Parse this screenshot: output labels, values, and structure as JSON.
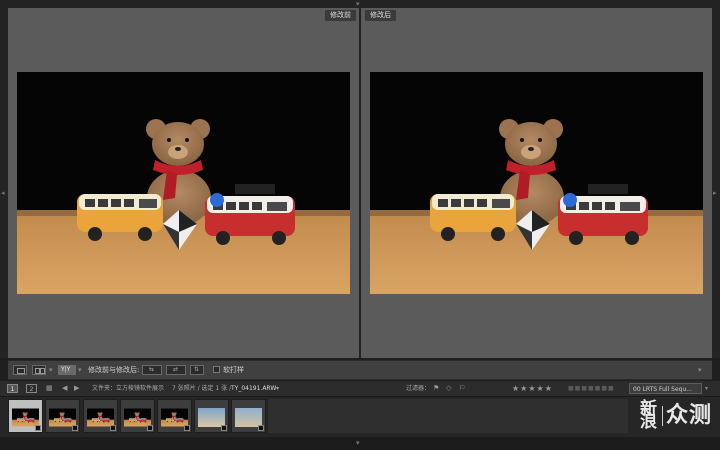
{
  "panes": {
    "before_label": "修改前",
    "after_label": "修改后"
  },
  "toolbar": {
    "view_mode_icons": [
      "loupe-icon",
      "compare-icon",
      "yy-icon"
    ],
    "yy_label": "Y|Y",
    "before_after_label": "修改前与修改后:",
    "soft_proof_label": "软打样"
  },
  "filmbar": {
    "page1": "1",
    "page2": "2",
    "source_text": "文件夹：立方棱镜软件展示",
    "count_text": "7 张照片 / 选定 1 张 /",
    "filename": "TY_04191.ARW",
    "filter_label": "过滤器：",
    "stars": "★★★★★",
    "preset": "00 LRTS Full Sequ..."
  },
  "filmstrip": {
    "thumbnails": [
      {
        "id": "t1",
        "selected": true
      },
      {
        "id": "t2",
        "selected": false
      },
      {
        "id": "t3",
        "selected": false
      },
      {
        "id": "t4",
        "selected": false
      },
      {
        "id": "t5",
        "selected": false
      },
      {
        "id": "t6",
        "selected": false
      },
      {
        "id": "t7",
        "selected": false
      }
    ]
  },
  "watermark": {
    "line1": "新",
    "line2": "浪",
    "text": "众测"
  },
  "colors": {
    "pane_bg": "#5b5b5b",
    "app_bg": "#1f1f1f",
    "toolbar_bg": "#404040"
  }
}
